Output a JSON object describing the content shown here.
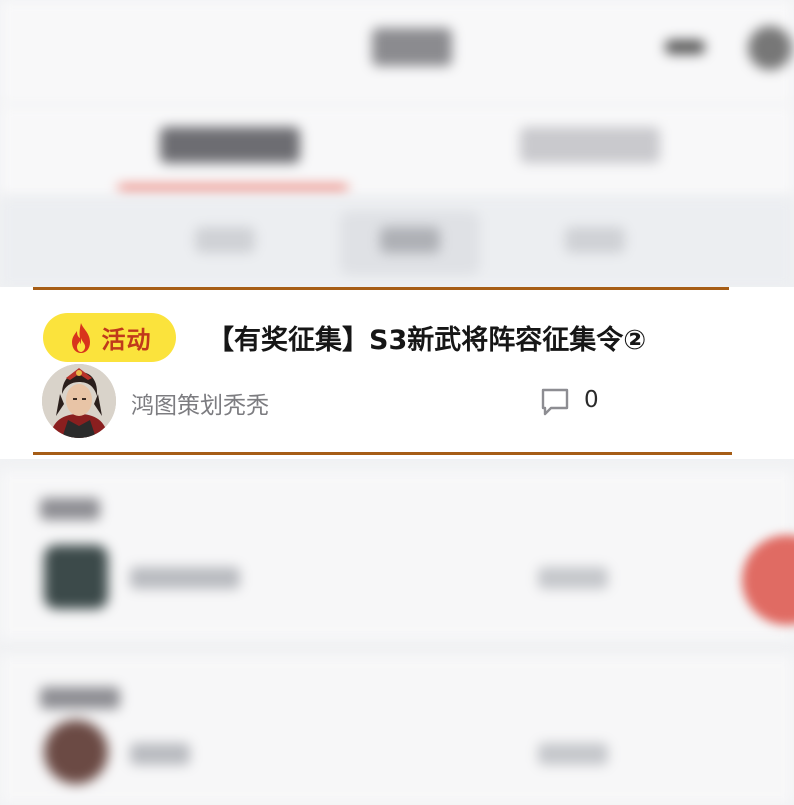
{
  "post": {
    "badge_label": "活动",
    "title": "【有奖征集】S3新武将阵容征集令②",
    "author": "鸿图策划秃秃",
    "comment_count": "0"
  },
  "icons": {
    "badge_icon": "flame-icon",
    "comment_icon": "comment-bubble-icon"
  },
  "colors": {
    "badge_bg": "#fbe33c",
    "badge_text": "#c0391b",
    "highlight_border": "#a65d16",
    "tab_indicator": "#e8695e"
  }
}
